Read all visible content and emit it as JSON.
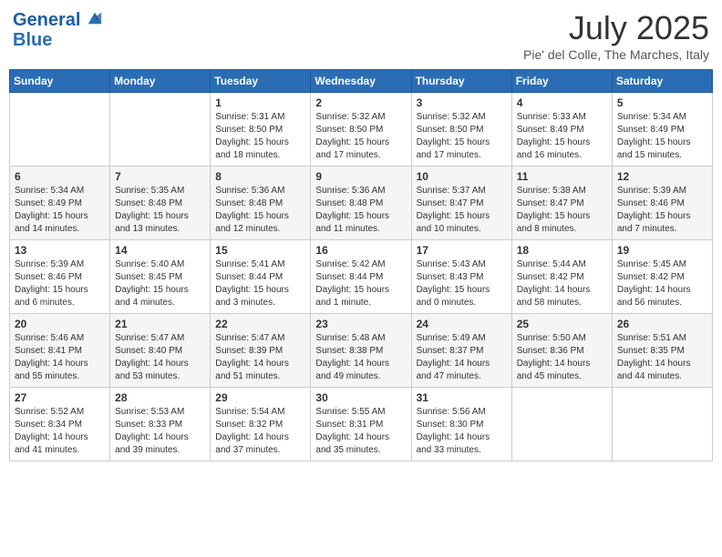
{
  "header": {
    "logo_line1": "General",
    "logo_line2": "Blue",
    "month": "July 2025",
    "location": "Pie' del Colle, The Marches, Italy"
  },
  "weekdays": [
    "Sunday",
    "Monday",
    "Tuesday",
    "Wednesday",
    "Thursday",
    "Friday",
    "Saturday"
  ],
  "weeks": [
    [
      {
        "day": "",
        "info": ""
      },
      {
        "day": "",
        "info": ""
      },
      {
        "day": "1",
        "info": "Sunrise: 5:31 AM\nSunset: 8:50 PM\nDaylight: 15 hours\nand 18 minutes."
      },
      {
        "day": "2",
        "info": "Sunrise: 5:32 AM\nSunset: 8:50 PM\nDaylight: 15 hours\nand 17 minutes."
      },
      {
        "day": "3",
        "info": "Sunrise: 5:32 AM\nSunset: 8:50 PM\nDaylight: 15 hours\nand 17 minutes."
      },
      {
        "day": "4",
        "info": "Sunrise: 5:33 AM\nSunset: 8:49 PM\nDaylight: 15 hours\nand 16 minutes."
      },
      {
        "day": "5",
        "info": "Sunrise: 5:34 AM\nSunset: 8:49 PM\nDaylight: 15 hours\nand 15 minutes."
      }
    ],
    [
      {
        "day": "6",
        "info": "Sunrise: 5:34 AM\nSunset: 8:49 PM\nDaylight: 15 hours\nand 14 minutes."
      },
      {
        "day": "7",
        "info": "Sunrise: 5:35 AM\nSunset: 8:48 PM\nDaylight: 15 hours\nand 13 minutes."
      },
      {
        "day": "8",
        "info": "Sunrise: 5:36 AM\nSunset: 8:48 PM\nDaylight: 15 hours\nand 12 minutes."
      },
      {
        "day": "9",
        "info": "Sunrise: 5:36 AM\nSunset: 8:48 PM\nDaylight: 15 hours\nand 11 minutes."
      },
      {
        "day": "10",
        "info": "Sunrise: 5:37 AM\nSunset: 8:47 PM\nDaylight: 15 hours\nand 10 minutes."
      },
      {
        "day": "11",
        "info": "Sunrise: 5:38 AM\nSunset: 8:47 PM\nDaylight: 15 hours\nand 8 minutes."
      },
      {
        "day": "12",
        "info": "Sunrise: 5:39 AM\nSunset: 8:46 PM\nDaylight: 15 hours\nand 7 minutes."
      }
    ],
    [
      {
        "day": "13",
        "info": "Sunrise: 5:39 AM\nSunset: 8:46 PM\nDaylight: 15 hours\nand 6 minutes."
      },
      {
        "day": "14",
        "info": "Sunrise: 5:40 AM\nSunset: 8:45 PM\nDaylight: 15 hours\nand 4 minutes."
      },
      {
        "day": "15",
        "info": "Sunrise: 5:41 AM\nSunset: 8:44 PM\nDaylight: 15 hours\nand 3 minutes."
      },
      {
        "day": "16",
        "info": "Sunrise: 5:42 AM\nSunset: 8:44 PM\nDaylight: 15 hours\nand 1 minute."
      },
      {
        "day": "17",
        "info": "Sunrise: 5:43 AM\nSunset: 8:43 PM\nDaylight: 15 hours\nand 0 minutes."
      },
      {
        "day": "18",
        "info": "Sunrise: 5:44 AM\nSunset: 8:42 PM\nDaylight: 14 hours\nand 58 minutes."
      },
      {
        "day": "19",
        "info": "Sunrise: 5:45 AM\nSunset: 8:42 PM\nDaylight: 14 hours\nand 56 minutes."
      }
    ],
    [
      {
        "day": "20",
        "info": "Sunrise: 5:46 AM\nSunset: 8:41 PM\nDaylight: 14 hours\nand 55 minutes."
      },
      {
        "day": "21",
        "info": "Sunrise: 5:47 AM\nSunset: 8:40 PM\nDaylight: 14 hours\nand 53 minutes."
      },
      {
        "day": "22",
        "info": "Sunrise: 5:47 AM\nSunset: 8:39 PM\nDaylight: 14 hours\nand 51 minutes."
      },
      {
        "day": "23",
        "info": "Sunrise: 5:48 AM\nSunset: 8:38 PM\nDaylight: 14 hours\nand 49 minutes."
      },
      {
        "day": "24",
        "info": "Sunrise: 5:49 AM\nSunset: 8:37 PM\nDaylight: 14 hours\nand 47 minutes."
      },
      {
        "day": "25",
        "info": "Sunrise: 5:50 AM\nSunset: 8:36 PM\nDaylight: 14 hours\nand 45 minutes."
      },
      {
        "day": "26",
        "info": "Sunrise: 5:51 AM\nSunset: 8:35 PM\nDaylight: 14 hours\nand 44 minutes."
      }
    ],
    [
      {
        "day": "27",
        "info": "Sunrise: 5:52 AM\nSunset: 8:34 PM\nDaylight: 14 hours\nand 41 minutes."
      },
      {
        "day": "28",
        "info": "Sunrise: 5:53 AM\nSunset: 8:33 PM\nDaylight: 14 hours\nand 39 minutes."
      },
      {
        "day": "29",
        "info": "Sunrise: 5:54 AM\nSunset: 8:32 PM\nDaylight: 14 hours\nand 37 minutes."
      },
      {
        "day": "30",
        "info": "Sunrise: 5:55 AM\nSunset: 8:31 PM\nDaylight: 14 hours\nand 35 minutes."
      },
      {
        "day": "31",
        "info": "Sunrise: 5:56 AM\nSunset: 8:30 PM\nDaylight: 14 hours\nand 33 minutes."
      },
      {
        "day": "",
        "info": ""
      },
      {
        "day": "",
        "info": ""
      }
    ]
  ]
}
